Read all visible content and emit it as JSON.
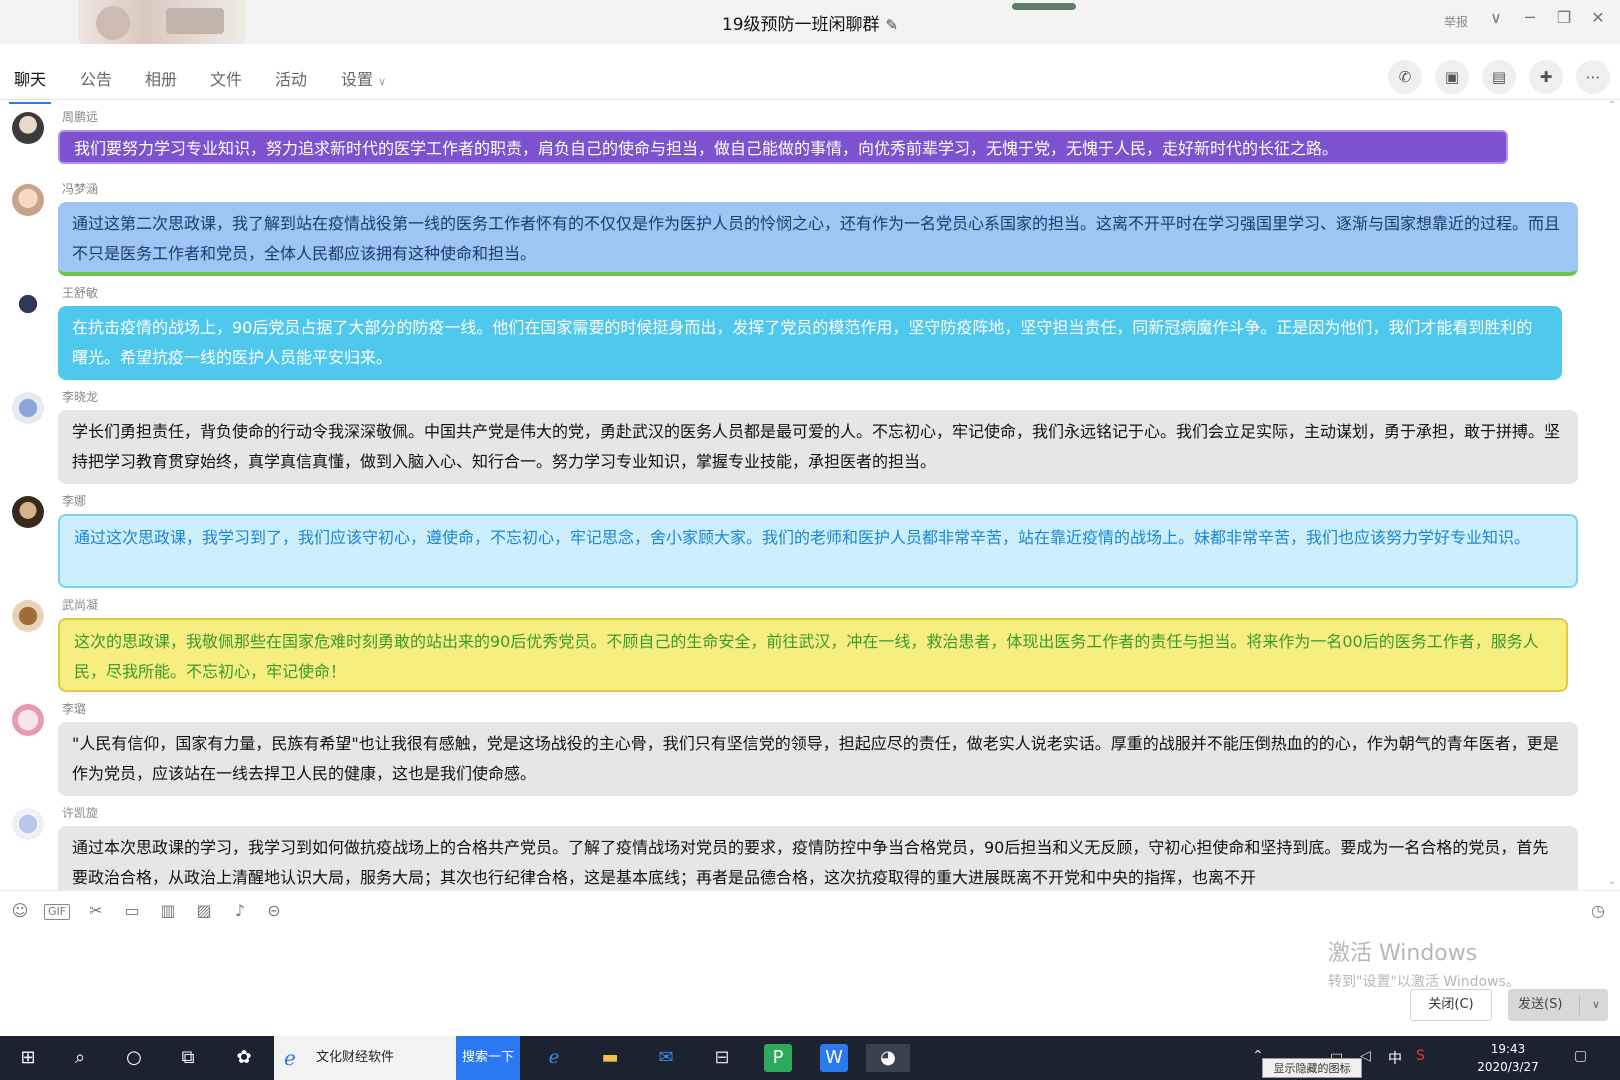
{
  "window": {
    "title": "19级预防一班闲聊群",
    "report_label": "举报",
    "controls": [
      "∨",
      "─",
      "❐",
      "✕"
    ]
  },
  "tabs": [
    {
      "label": "聊天",
      "active": true
    },
    {
      "label": "公告",
      "active": false
    },
    {
      "label": "相册",
      "active": false
    },
    {
      "label": "文件",
      "active": false
    },
    {
      "label": "活动",
      "active": false
    },
    {
      "label": "设置",
      "active": false
    }
  ],
  "toolbar_icons": [
    "phone-icon",
    "video-icon",
    "screen-share-icon",
    "chat-add-icon",
    "more-icon"
  ],
  "messages": [
    {
      "sender": "周鹏远",
      "text": "我们要努力学习专业知识，努力追求新时代的医学工作者的职责，肩负自己的使命与担当，做自己能做的事情，向优秀前辈学习，无愧于党，无愧于人民，走好新时代的长征之路。",
      "bg": "#7c52cf",
      "color": "#ffffff",
      "border": "#b48ef0"
    },
    {
      "sender": "冯梦涵",
      "text": "通过这第二次思政课，我了解到站在疫情战役第一线的医务工作者怀有的不仅仅是作为医护人员的怜悯之心，还有作为一名党员心系国家的担当。这离不开平时在学习强国里学习、逐渐与国家想靠近的过程。而且不只是医务工作者和党员，全体人民都应该拥有这种使命和担当。",
      "bg": "#9ec5f4",
      "color": "#1c3b6e",
      "border": "#6dc44a"
    },
    {
      "sender": "王舒敏",
      "text": "在抗击疫情的战场上，90后党员占据了大部分的防疫一线。他们在国家需要的时候挺身而出，发挥了党员的模范作用，坚守防疫阵地，坚守担当责任，同新冠病魔作斗争。正是因为他们，我们才能看到胜利的曙光。希望抗疫一线的医护人员能平安归来。",
      "bg": "#4fc8ee",
      "color": "#ffffff",
      "border": "#4fc8ee"
    },
    {
      "sender": "李晓龙",
      "text": "学长们勇担责任，背负使命的行动令我深深敬佩。中国共产党是伟大的党，勇赴武汉的医务人员都是最可爱的人。不忘初心，牢记使命，我们永远铭记于心。我们会立足实际，主动谋划，勇于承担，敢于拼搏。坚持把学习教育贯穿始终，真学真信真懂，做到入脑入心、知行合一。努力学习专业知识，掌握专业技能，承担医者的担当。",
      "bg": "#e6e6e6",
      "color": "#111111",
      "border": "#e6e6e6"
    },
    {
      "sender": "李娜",
      "text": "通过这次思政课，我学习到了，我们应该守初心，遵使命，不忘初心，牢记思念，舍小家顾大家。我们的老师和医护人员都非常辛苦，站在靠近疫情的战场上。妹都非常辛苦，我们也应该努力学好专业知识。",
      "bg": "#cdeefb",
      "color": "#1a86d6",
      "border": "#7ad3f2"
    },
    {
      "sender": "武尚凝",
      "text": "这次的思政课，我敬佩那些在国家危难时刻勇敢的站出来的90后优秀党员。不顾自己的生命安全，前往武汉，冲在一线，救治患者，体现出医务工作者的责任与担当。将来作为一名00后的医务工作者，服务人民，尽我所能。不忘初心，牢记使命！",
      "bg": "#f6ee7e",
      "color": "#3a9a32",
      "border": "#e2c74a"
    },
    {
      "sender": "李璐",
      "text": "\"人民有信仰，国家有力量，民族有希望\"也让我很有感触，党是这场战役的主心骨，我们只有坚信党的领导，担起应尽的责任，做老实人说老实话。厚重的战服并不能压倒热血的的心，作为朝气的青年医者，更是作为党员，应该站在一线去捍卫人民的健康，这也是我们使命感。",
      "bg": "#e6e6e6",
      "color": "#111111",
      "border": "#e6e6e6"
    },
    {
      "sender": "许凯旋",
      "text": "通过本次思政课的学习，我学习到如何做抗疫战场上的合格共产党员。了解了疫情战场对党员的要求，疫情防控中争当合格党员，90后担当和义无反顾，守初心担使命和坚持到底。要成为一名合格的党员，首先要政治合格，从政治上清醒地认识大局，服务大局；其次也行纪律合格，这是基本底线；再者是品德合格，这次抗疫取得的重大进展既离不开党和中央的指挥，也离不开",
      "bg": "#e6e6e6",
      "color": "#111111",
      "border": "#e6e6e6"
    }
  ],
  "input_icons": [
    "emoji-icon",
    "gif-icon",
    "scissors-icon",
    "folder-icon",
    "red-packet-icon",
    "image-icon",
    "bell-icon",
    "more-circle-icon"
  ],
  "watermark": {
    "line1": "激活 Windows",
    "line2": "转到\"设置\"以激活 Windows。"
  },
  "buttons": {
    "close": "关闭(C)",
    "send": "发送(S)"
  },
  "taskbar": {
    "app_label": "文化财经软件",
    "search_label": "搜索一下",
    "time": "19:43",
    "date": "2020/3/27",
    "tooltip": "显示隐藏的图标",
    "ime": "中"
  }
}
